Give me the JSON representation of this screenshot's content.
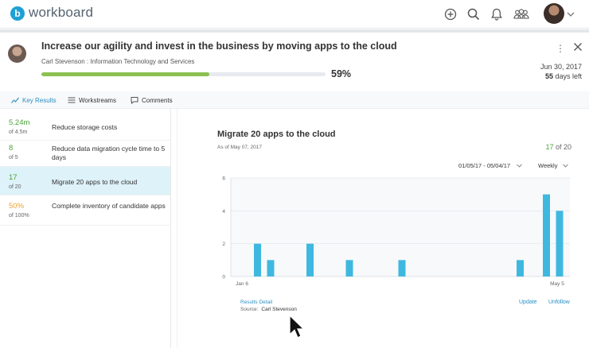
{
  "app": {
    "brand": "workboard",
    "logo_letter": "b"
  },
  "topbar": {
    "icons": [
      "add-icon",
      "search-icon",
      "bell-icon",
      "team-icon"
    ],
    "user_menu_icon": "chevron-down-icon"
  },
  "objective": {
    "title": "Increase our agility and invest in the business by moving apps to the cloud",
    "owner": "Carl Stevenson : Information Technology and Services",
    "progress": 0.59,
    "progress_label": "59%",
    "due_date": "Jun 30, 2017",
    "days_left_value": "55",
    "days_left_suffix": "days left",
    "progress_color": "#8cc152"
  },
  "tabs": [
    {
      "label": "Key Results",
      "icon": "chart-line-icon",
      "active": true
    },
    {
      "label": "Workstreams",
      "icon": "workstreams-icon",
      "active": false
    },
    {
      "label": "Comments",
      "icon": "comment-icon",
      "active": false
    }
  ],
  "key_results": [
    {
      "value": "5.24m",
      "target": "of 4.5m",
      "label": "Reduce storage costs",
      "value_color": "#4aa33a",
      "selected": false
    },
    {
      "value": "8",
      "target": "of 5",
      "label": "Reduce data migration cycle time to 5 days",
      "value_color": "#4aa33a",
      "selected": false
    },
    {
      "value": "17",
      "target": "of 20",
      "label": "Migrate 20 apps to the cloud",
      "value_color": "#4aa33a",
      "selected": true
    },
    {
      "value": "50%",
      "target": "of 100%",
      "label": "Complete inventory of candidate apps",
      "value_color": "#f0a030",
      "selected": false
    }
  ],
  "detail": {
    "title": "Migrate 20 apps to the cloud",
    "as_of": "As of May 07, 2017",
    "current": "17",
    "of_label": "of 20",
    "date_range": "01/05/17 - 05/04/17",
    "frequency": "Weekly",
    "results_detail_link": "Results Detail",
    "source_label": "Source:",
    "source_name": "Carl Stevenson",
    "update_link": "Update",
    "unfollow_link": "Unfollow"
  },
  "chart_data": {
    "type": "bar",
    "x_start_label": "Jan 6",
    "x_end_label": "May 5",
    "values": [
      0,
      2,
      1,
      0,
      0,
      2,
      0,
      0,
      1,
      0,
      0,
      0,
      1,
      0,
      0,
      0,
      0,
      0,
      0,
      0,
      0,
      1,
      0,
      5,
      4
    ],
    "ylim": [
      0,
      6
    ],
    "yticks": [
      0,
      2,
      4,
      6
    ],
    "bar_color": "#3fb8e0",
    "grid": true
  }
}
